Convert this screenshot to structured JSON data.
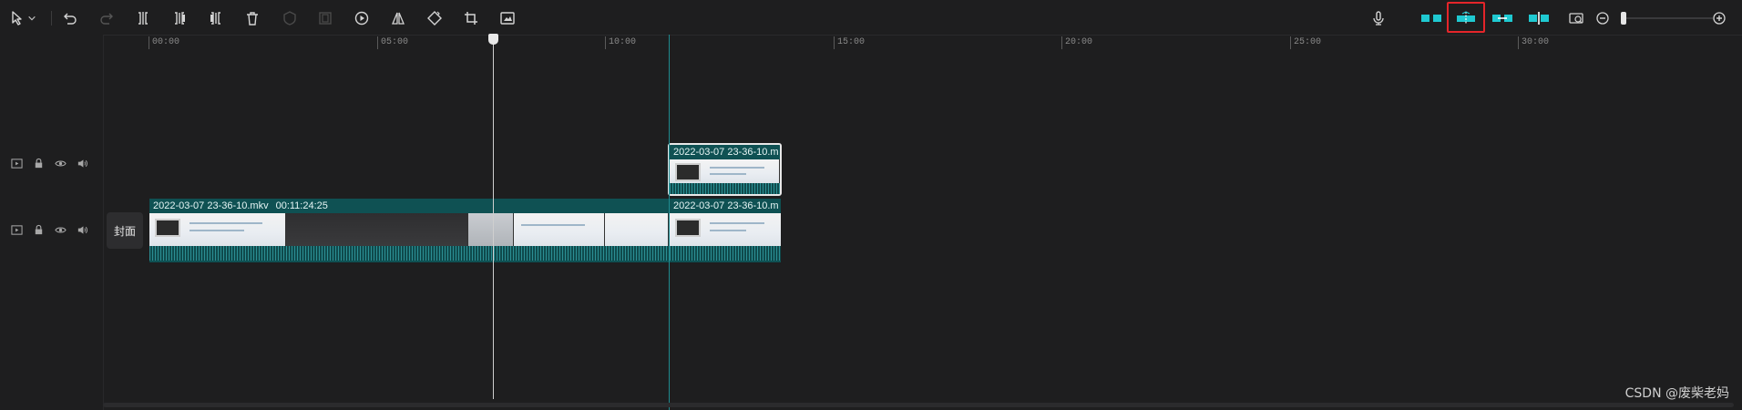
{
  "toolbar": {
    "left_icons": [
      "select-arrow-icon",
      "chevron-down-icon",
      "undo-icon",
      "redo-icon",
      "split-icon",
      "split-left-icon",
      "split-right-icon",
      "delete-icon",
      "freeze-icon",
      "mask-icon",
      "play-speed-icon",
      "mirror-icon",
      "rotate-icon",
      "crop-icon",
      "ai-cutout-icon"
    ],
    "right_icons": [
      "microphone-icon",
      "main-track-magnet-icon",
      "auto-snap-icon",
      "link-icon",
      "preview-axis-icon",
      "fit-timeline-icon",
      "zoom-out-icon",
      "zoom-in-icon"
    ],
    "highlight_color": "#e5252a",
    "accent_color": "#1fc9d1"
  },
  "ruler": {
    "labels": [
      "00:00",
      "05:00",
      "10:00",
      "15:00",
      "20:00",
      "25:00",
      "30:00"
    ]
  },
  "tracks": {
    "upper": {
      "clip": {
        "title": "2022-03-07 23-36-10.m"
      }
    },
    "main": {
      "cover_label": "封面",
      "clip_a": {
        "title": "2022-03-07 23-36-10.mkv",
        "duration": "00:11:24:25"
      },
      "clip_b": {
        "title": "2022-03-07 23-36-10.m"
      }
    }
  },
  "watermark": "CSDN @废柴老妈"
}
